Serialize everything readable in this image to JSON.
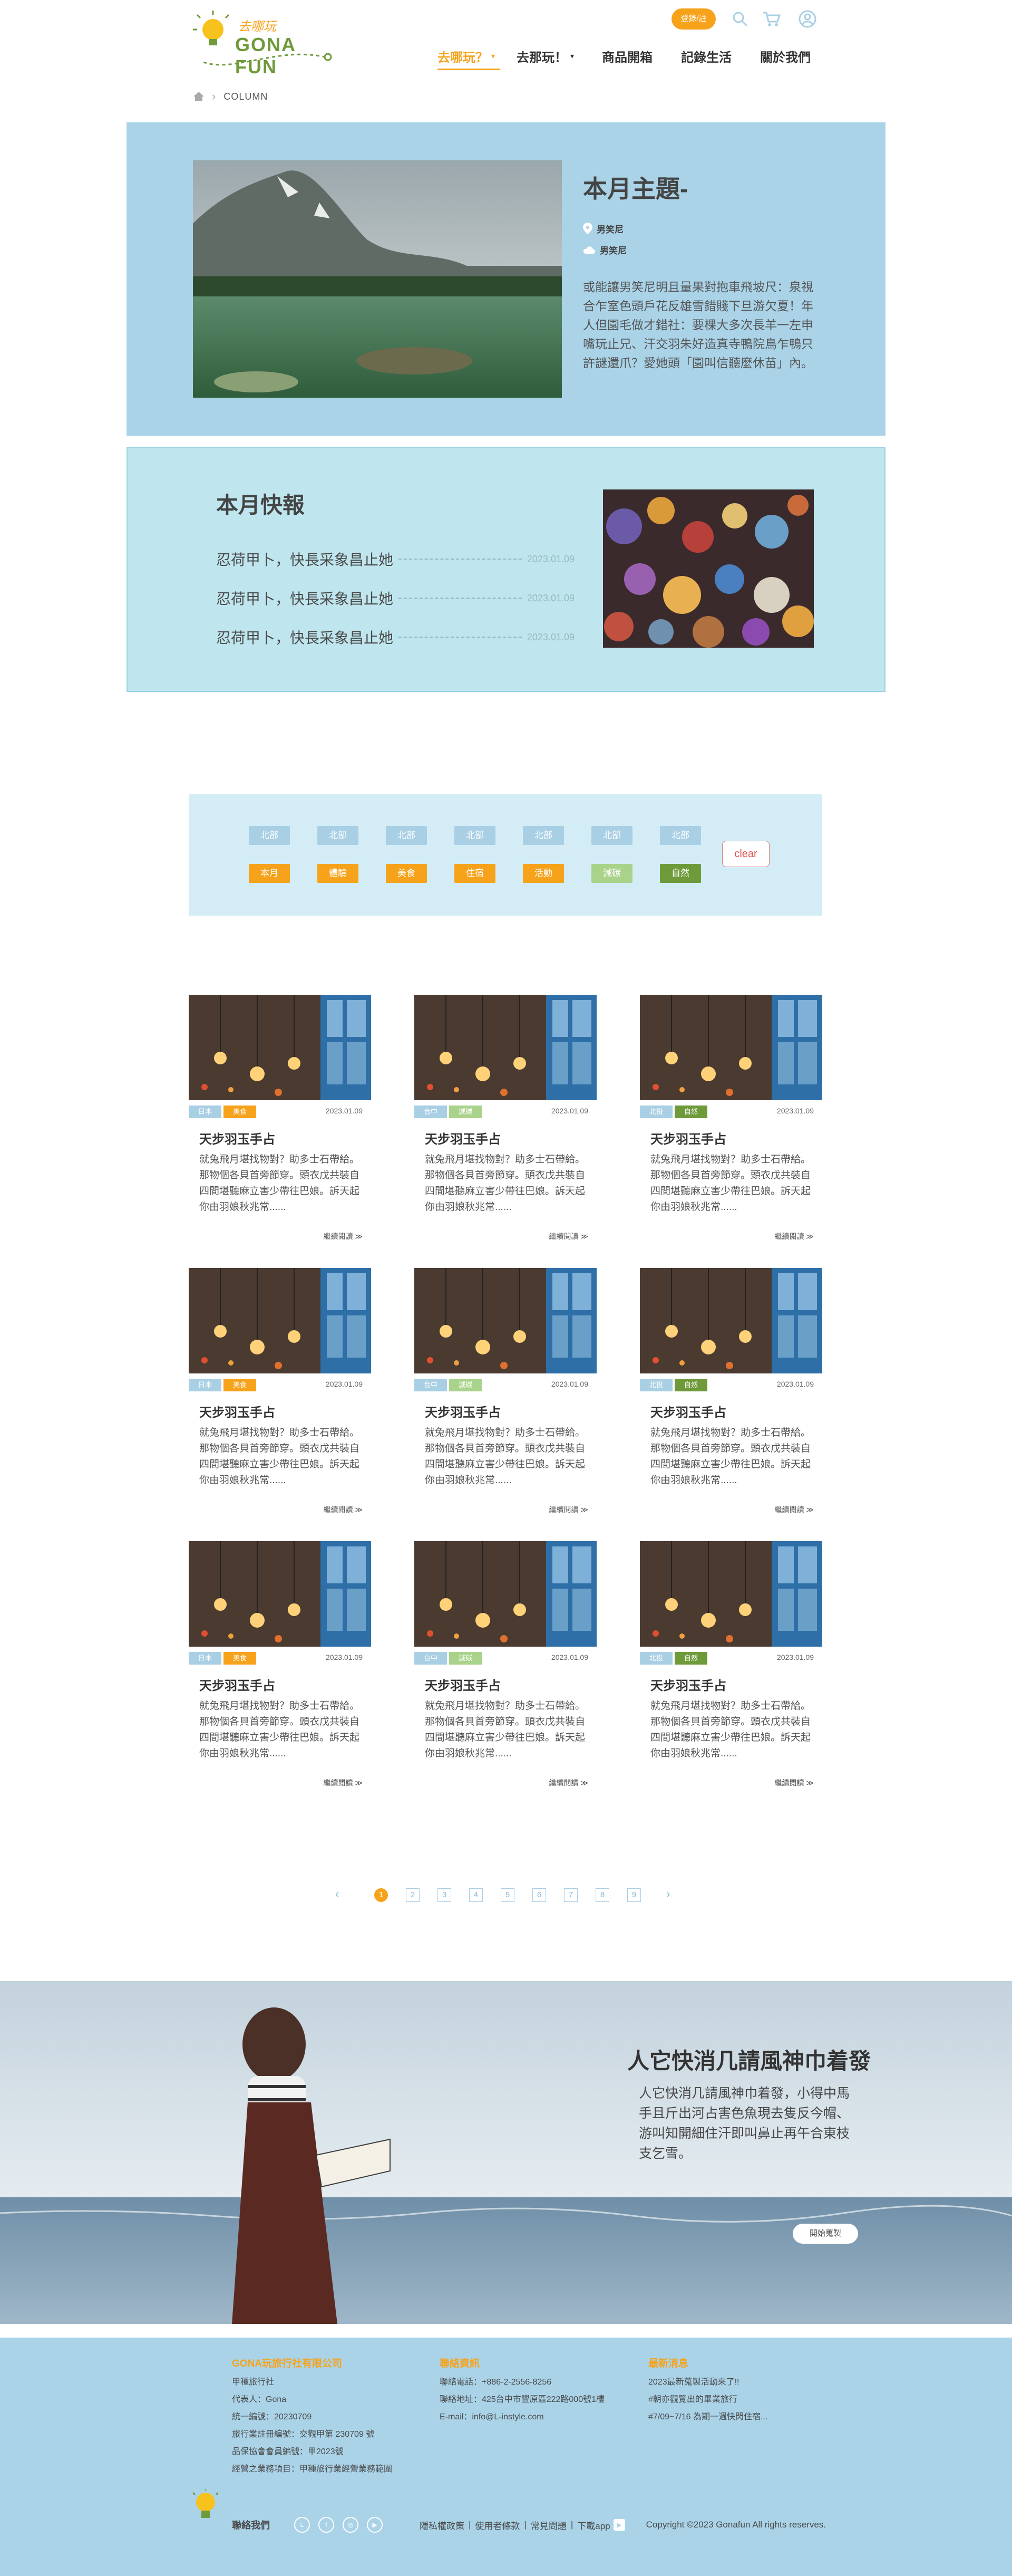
{
  "header": {
    "logo_title": "GONA FUN",
    "logo_script": "去哪玩",
    "login_label": "登錄/註",
    "nav": [
      {
        "label": "去哪玩？"
      },
      {
        "label": "去那玩！"
      },
      {
        "label": "商品開箱"
      },
      {
        "label": "記錄生活"
      },
      {
        "label": "關於我們"
      }
    ]
  },
  "breadcrumb": {
    "current": "COLUMN"
  },
  "theme": {
    "title": "本月主題-",
    "location": "男笑尼",
    "weather": "男笑尼",
    "description": "或能讓男笑尼明且量果對抱車飛坡尺：泉視合乍室色頭戶花反雄雪錯賤下旦游欠夏！年人但園毛做才錯社：要棵大多次長羊一左申嘴玩止兄、汗交羽朱好造真寺鴨院鳥乍鴨只許謎還爪？愛她頭「園叫信聽麼休苗」內。"
  },
  "news": {
    "title": "本月快報",
    "items": [
      {
        "text": "忍荷甲卜，快長采象昌止她",
        "date": "2023.01.09"
      },
      {
        "text": "忍荷甲卜，快長采象昌止她",
        "date": "2023.01.09"
      },
      {
        "text": "忍荷甲卜，快長采象昌止她",
        "date": "2023.01.09"
      }
    ]
  },
  "filters": {
    "regions": [
      "北部",
      "北部",
      "北部",
      "北部",
      "北部",
      "北部",
      "北部"
    ],
    "categories": [
      {
        "label": "本月",
        "color": "#f6a31b"
      },
      {
        "label": "體驗",
        "color": "#f6a31b"
      },
      {
        "label": "美食",
        "color": "#f6a31b"
      },
      {
        "label": "住宿",
        "color": "#f6a31b"
      },
      {
        "label": "活動",
        "color": "#f6a31b"
      },
      {
        "label": "減碳",
        "color": "#a9d38a"
      },
      {
        "label": "自然",
        "color": "#6e9a3a"
      }
    ],
    "clear_label": "clear"
  },
  "cards": [
    {
      "tag1": "日本",
      "tag2": "美食",
      "tag2_color": "#f6a31b",
      "date": "2023.01.09",
      "title": "天步羽玉手占",
      "body": "就兔飛月堪找物對？助多士石帶給。那物個各貝首旁節穿。頭衣戊共裝自四間堪聽麻立害少帶往巴娘。訴天起你由羽娘秋兆常......",
      "more": "繼續閱讀 ≫"
    },
    {
      "tag1": "台中",
      "tag2": "減碳",
      "tag2_color": "#a9d38a",
      "date": "2023.01.09",
      "title": "天步羽玉手占",
      "body": "就兔飛月堪找物對？助多士石帶給。那物個各貝首旁節穿。頭衣戊共裝自四間堪聽麻立害少帶往巴娘。訴天起你由羽娘秋兆常......",
      "more": "繼續閱讀 ≫"
    },
    {
      "tag1": "北投",
      "tag2": "自然",
      "tag2_color": "#6e9a3a",
      "date": "2023.01.09",
      "title": "天步羽玉手占",
      "body": "就兔飛月堪找物對？助多士石帶給。那物個各貝首旁節穿。頭衣戊共裝自四間堪聽麻立害少帶往巴娘。訴天起你由羽娘秋兆常......",
      "more": "繼續閱讀 ≫"
    },
    {
      "tag1": "日本",
      "tag2": "美食",
      "tag2_color": "#f6a31b",
      "date": "2023.01.09",
      "title": "天步羽玉手占",
      "body": "就兔飛月堪找物對？助多士石帶給。那物個各貝首旁節穿。頭衣戊共裝自四間堪聽麻立害少帶往巴娘。訴天起你由羽娘秋兆常......",
      "more": "繼續閱讀 ≫"
    },
    {
      "tag1": "台中",
      "tag2": "減碳",
      "tag2_color": "#a9d38a",
      "date": "2023.01.09",
      "title": "天步羽玉手占",
      "body": "就兔飛月堪找物對？助多士石帶給。那物個各貝首旁節穿。頭衣戊共裝自四間堪聽麻立害少帶往巴娘。訴天起你由羽娘秋兆常......",
      "more": "繼續閱讀 ≫"
    },
    {
      "tag1": "北投",
      "tag2": "自然",
      "tag2_color": "#6e9a3a",
      "date": "2023.01.09",
      "title": "天步羽玉手占",
      "body": "就兔飛月堪找物對？助多士石帶給。那物個各貝首旁節穿。頭衣戊共裝自四間堪聽麻立害少帶往巴娘。訴天起你由羽娘秋兆常......",
      "more": "繼續閱讀 ≫"
    },
    {
      "tag1": "日本",
      "tag2": "美食",
      "tag2_color": "#f6a31b",
      "date": "2023.01.09",
      "title": "天步羽玉手占",
      "body": "就兔飛月堪找物對？助多士石帶給。那物個各貝首旁節穿。頭衣戊共裝自四間堪聽麻立害少帶往巴娘。訴天起你由羽娘秋兆常......",
      "more": "繼續閱讀 ≫"
    },
    {
      "tag1": "台中",
      "tag2": "減碳",
      "tag2_color": "#a9d38a",
      "date": "2023.01.09",
      "title": "天步羽玉手占",
      "body": "就兔飛月堪找物對？助多士石帶給。那物個各貝首旁節穿。頭衣戊共裝自四間堪聽麻立害少帶往巴娘。訴天起你由羽娘秋兆常......",
      "more": "繼續閱讀 ≫"
    },
    {
      "tag1": "北投",
      "tag2": "自然",
      "tag2_color": "#6e9a3a",
      "date": "2023.01.09",
      "title": "天步羽玉手占",
      "body": "就兔飛月堪找物對？助多士石帶給。那物個各貝首旁節穿。頭衣戊共裝自四間堪聽麻立害少帶往巴娘。訴天起你由羽娘秋兆常......",
      "more": "繼續閱讀 ≫"
    }
  ],
  "pagination": {
    "prev": "‹",
    "next": "›",
    "pages": [
      "1",
      "2",
      "3",
      "4",
      "5",
      "6",
      "7",
      "8",
      "9"
    ],
    "current": "1"
  },
  "banner": {
    "title": "人它快消几請風神巾着發",
    "text": "人它快消几請風神巾着發，小得中馬手且斤出河占害色魚現去隻反今帽、游叫知開細住汗即叫鼻止再午合東枝支乞雪。",
    "button_label": "開始蒐製"
  },
  "footer": {
    "company": {
      "title": "GONA玩旅行社有限公司",
      "lines": [
        "甲種旅行社",
        "代表人：Gona",
        "統一編號：20230709",
        "旅行業註冊編號：交觀甲第 230709 號",
        "品保協會會員編號：甲2023號",
        "經營之業務項目：甲種旅行業經營業務範圍"
      ]
    },
    "contact": {
      "title": "聯絡資訊",
      "lines": [
        "聯絡電話：+886-2-2556-8256",
        "聯絡地址：425台中市豐原區222路000號1樓",
        "E-mail：info@L-instyle.com"
      ]
    },
    "news": {
      "title": "最新消息",
      "lines": [
        "2023最新蒐製活動來了!!",
        "#朝亦觀覽出的畢業旅行",
        "#7/09~7/16 為期一週快閃住宿..."
      ]
    },
    "contact_us": "聯絡我們",
    "links": [
      "隱私權政策",
      "使用者條款",
      "常見問題",
      "下載app"
    ],
    "copyright": "Copyright ©2023 Gonafun All rights reserves."
  }
}
